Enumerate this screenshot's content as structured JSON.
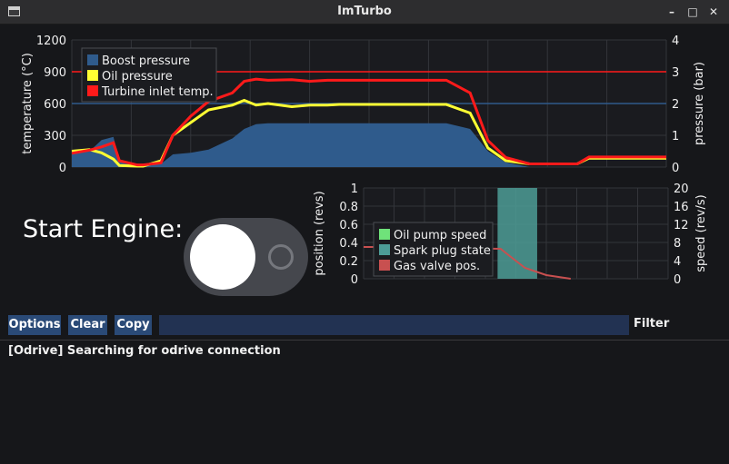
{
  "window": {
    "title": "ImTurbo",
    "controls": [
      "minimize",
      "maximize",
      "close"
    ],
    "icons": [
      "app-window-icon",
      "minimize-icon",
      "maximize-icon",
      "close-icon"
    ]
  },
  "colors": {
    "boost": "#2f5b8c",
    "oil": "#ffff33",
    "turbine": "#ff1a1a",
    "pump": "#6fe27a",
    "spark": "#4d9c97",
    "valve": "#c85050",
    "button": "#2a4a77"
  },
  "chart_data": [
    {
      "type": "line",
      "title": "",
      "xlabel": "",
      "ylabel": "temperature (°C)",
      "y2label": "pressure (bar)",
      "ylim": [
        0,
        1200
      ],
      "y2lim": [
        0,
        4
      ],
      "yticks": [
        "1200",
        "900",
        "600",
        "300",
        "0"
      ],
      "y2ticks": [
        "4",
        "3",
        "2",
        "1",
        "0"
      ],
      "grid": true,
      "legend": "top-left",
      "reference_lines": [
        {
          "y": 900,
          "color": "#ff1a1a"
        },
        {
          "y2": 2,
          "color": "#2f5b8c"
        }
      ],
      "x": [
        0,
        3,
        5,
        7,
        8,
        11,
        12,
        15,
        17,
        20,
        23,
        27,
        29,
        31,
        33,
        37,
        40,
        43,
        45,
        48,
        50,
        53,
        57,
        60,
        63,
        67,
        70,
        73,
        77,
        80,
        82,
        85,
        87,
        90,
        93,
        97,
        100
      ],
      "series": [
        {
          "name": "Boost pressure",
          "axis": "y2",
          "color": "#2f5b8c",
          "values": [
            0.4,
            0.5,
            0.85,
            0.95,
            0.2,
            0.05,
            0.05,
            0.1,
            0.4,
            0.45,
            0.55,
            0.9,
            1.2,
            1.35,
            1.38,
            1.38,
            1.38,
            1.38,
            1.38,
            1.38,
            1.38,
            1.38,
            1.38,
            1.38,
            1.38,
            1.2,
            0.5,
            0.15,
            0.0,
            0.0,
            0.0,
            0.0,
            0.0,
            0.0,
            0.0,
            0.0,
            0.0
          ]
        },
        {
          "name": "Oil pressure",
          "axis": "y2",
          "color": "#ffff33",
          "values": [
            0.5,
            0.55,
            0.45,
            0.25,
            0.05,
            0.03,
            0.03,
            0.2,
            1.0,
            1.4,
            1.8,
            1.95,
            2.1,
            1.95,
            2.0,
            1.9,
            1.95,
            1.95,
            1.97,
            1.97,
            1.97,
            1.97,
            1.97,
            1.97,
            1.97,
            1.7,
            0.6,
            0.2,
            0.1,
            0.1,
            0.1,
            0.1,
            0.28,
            0.28,
            0.28,
            0.28,
            0.28
          ]
        },
        {
          "name": "Turbine inlet temp.",
          "axis": "y",
          "color": "#ff1a1a",
          "values": [
            130,
            160,
            190,
            230,
            60,
            20,
            20,
            40,
            300,
            480,
            620,
            700,
            810,
            830,
            820,
            825,
            810,
            820,
            820,
            820,
            820,
            820,
            820,
            820,
            820,
            700,
            250,
            90,
            30,
            30,
            30,
            30,
            95,
            95,
            95,
            95,
            95
          ]
        }
      ]
    },
    {
      "type": "line",
      "title": "",
      "xlabel": "",
      "ylabel": "position (revs)",
      "y2label": "speed (rev/s)",
      "ylim": [
        0,
        1
      ],
      "y2lim": [
        0,
        20
      ],
      "yticks": [
        "1",
        "0.8",
        "0.6",
        "0.4",
        "0.2",
        "0"
      ],
      "y2ticks": [
        "20",
        "16",
        "12",
        "8",
        "4",
        "0"
      ],
      "grid": true,
      "legend": "top-left",
      "spark_band": {
        "x0": 0.44,
        "x1": 0.57
      },
      "series": [
        {
          "name": "Oil pump speed",
          "axis": "y2",
          "color": "#6fe27a",
          "x": [],
          "values": []
        },
        {
          "name": "Spark plug state",
          "axis": "y",
          "color": "#4d9c97",
          "x": [
            0.44,
            0.57
          ],
          "values": [
            1,
            1
          ]
        },
        {
          "name": "Gas valve pos.",
          "axis": "y",
          "color": "#c85050",
          "x": [
            0,
            0.04,
            0.45,
            0.48,
            0.53,
            0.6,
            0.68
          ],
          "values": [
            0.35,
            0.35,
            0.33,
            0.25,
            0.12,
            0.04,
            0.0
          ]
        }
      ]
    }
  ],
  "engine": {
    "label": "Start Engine:",
    "toggle_on": false
  },
  "toolbar": {
    "options_label": "Options",
    "clear_label": "Clear",
    "copy_label": "Copy",
    "filter_value": "",
    "filter_label": "Filter"
  },
  "log": {
    "lines": [
      "[Odrive] Searching for odrive connection"
    ]
  }
}
